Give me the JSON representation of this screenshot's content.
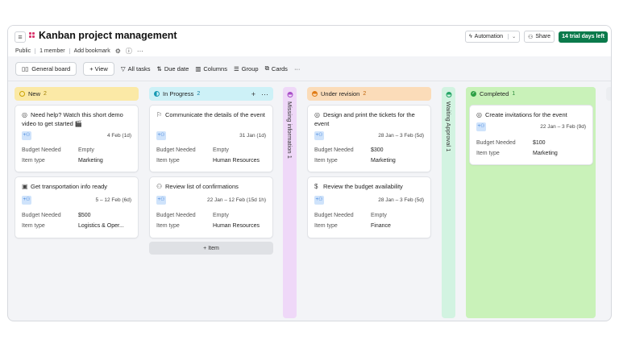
{
  "header": {
    "title": "Kanban project management",
    "visibility": "Public",
    "members": "1 member",
    "bookmark": "Add bookmark",
    "automation_label": "Automation",
    "share_label": "Share",
    "trial_badge": "14 trial days left"
  },
  "toolbar": {
    "view_name": "General board",
    "add_view": "+ View",
    "filter": "All tasks",
    "sort": "Due date",
    "columns": "Columns",
    "group": "Group",
    "cards": "Cards",
    "more": "···"
  },
  "columns": {
    "new": {
      "label": "New",
      "count": "2",
      "color": "#fbe9a6",
      "cards": [
        {
          "title": "Need help? Watch this short demo video to get started 🎬",
          "date": "4 Feb (1d)",
          "props": [
            {
              "key": "Budget Needed",
              "value": "Empty"
            },
            {
              "key": "Item type",
              "value": "Marketing"
            }
          ]
        },
        {
          "title": "Get transportation info ready",
          "date": "5 – 12 Feb (6d)",
          "props": [
            {
              "key": "Budget Needed",
              "value": "$500"
            },
            {
              "key": "Item type",
              "value": "Logistics & Oper..."
            }
          ]
        }
      ]
    },
    "in_progress": {
      "label": "In Progress",
      "count": "2",
      "color": "#cdf1f7",
      "add_item": "+ Item",
      "cards": [
        {
          "title": "Communicate the details of the event",
          "date": "31 Jan (1d)",
          "props": [
            {
              "key": "Budget Needed",
              "value": "Empty"
            },
            {
              "key": "Item type",
              "value": "Human Resources"
            }
          ]
        },
        {
          "title": "Review list of confirmations",
          "date": "22 Jan – 12 Feb (15d 1h)",
          "props": [
            {
              "key": "Budget Needed",
              "value": "Empty"
            },
            {
              "key": "Item type",
              "value": "Human Resources"
            }
          ]
        }
      ]
    },
    "missing_info": {
      "label": "Missing information",
      "count": "1",
      "color": "#efd8f8"
    },
    "under_revision": {
      "label": "Under revision",
      "count": "2",
      "color": "#fbdcb9",
      "cards": [
        {
          "title": "Design and print the tickets for the event",
          "date": "28 Jan – 3 Feb (5d)",
          "props": [
            {
              "key": "Budget Needed",
              "value": "$300"
            },
            {
              "key": "Item type",
              "value": "Marketing"
            }
          ]
        },
        {
          "title": "Review the budget availability",
          "date": "28 Jan – 3 Feb (5d)",
          "props": [
            {
              "key": "Budget Needed",
              "value": "Empty"
            },
            {
              "key": "Item type",
              "value": "Finance"
            }
          ]
        }
      ]
    },
    "waiting_approval": {
      "label": "Waiting Approval",
      "count": "1",
      "color": "#d2f3e1"
    },
    "completed": {
      "label": "Completed",
      "count": "1",
      "color": "#c9f2b9",
      "cards": [
        {
          "title": "Create invitations for the event",
          "date": "22 Jan – 3 Feb (9d)",
          "props": [
            {
              "key": "Budget Needed",
              "value": "$100"
            },
            {
              "key": "Item type",
              "value": "Marketing"
            }
          ]
        }
      ]
    }
  }
}
